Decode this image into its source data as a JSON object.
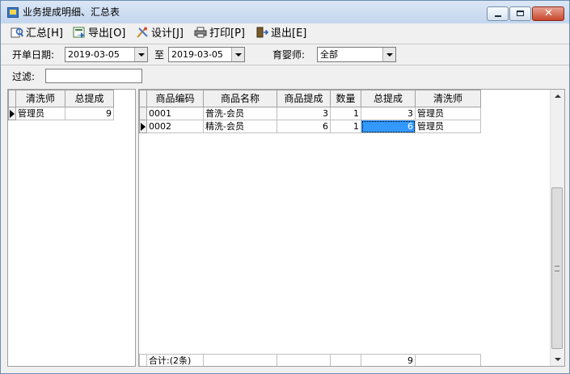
{
  "window": {
    "title": "业务提成明细、汇总表"
  },
  "toolbar": {
    "summary": "汇总[H]",
    "export": "导出[O]",
    "design": "设计[J]",
    "print": "打印[P]",
    "exit": "退出[E]"
  },
  "filters": {
    "date_label": "开单日期:",
    "date_from": "2019-03-05",
    "to_label": "至",
    "date_to": "2019-03-05",
    "nanny_label": "育婴师:",
    "nanny_value": "全部",
    "filter_label": "过滤:",
    "filter_value": ""
  },
  "summary_table": {
    "headers": [
      "清洗师",
      "总提成"
    ],
    "rows": [
      {
        "name": "管理员",
        "total": "9"
      }
    ]
  },
  "detail_table": {
    "headers": [
      "商品编码",
      "商品名称",
      "商品提成",
      "数量",
      "总提成",
      "清洗师"
    ],
    "rows": [
      {
        "code": "0001",
        "name": "普洗-会员",
        "commission": "3",
        "qty": "1",
        "total": "3",
        "cleaner": "管理员"
      },
      {
        "code": "0002",
        "name": "精洗-会员",
        "commission": "6",
        "qty": "1",
        "total": "6",
        "cleaner": "管理员"
      }
    ],
    "footer": {
      "label": "合计:(2条)",
      "total": "9"
    }
  }
}
